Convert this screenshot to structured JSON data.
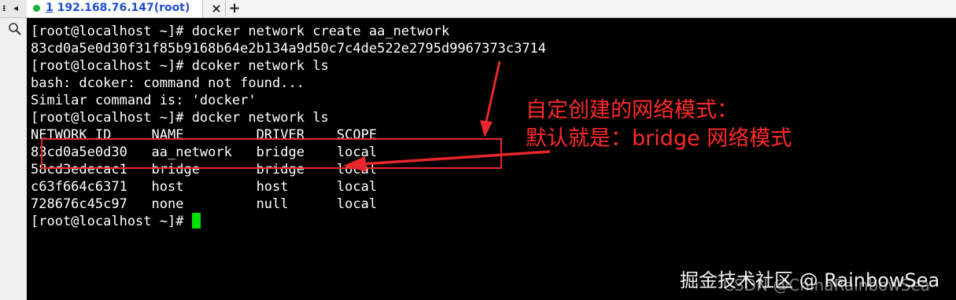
{
  "left_panel": {
    "pin_glyph": "ᵻ",
    "arrow_glyph": "◂",
    "search_icon": "magnifier"
  },
  "tabs": [
    {
      "number": "1",
      "title": "192.168.76.147(root)",
      "status_color": "#19b23b",
      "active": true
    }
  ],
  "tab_controls": {
    "close": "×",
    "add": "+"
  },
  "terminal": {
    "lines": [
      "[root@localhost ~]# docker network create aa_network",
      "83cd0a5e0d30f31f85b9168b64e2b134a9d50c7c4de522e2795d9967373c3714",
      "[root@localhost ~]# dcoker network ls",
      "bash: dcoker: command not found...",
      "Similar command is: 'docker'",
      "[root@localhost ~]# docker network ls",
      "NETWORK ID     NAME         DRIVER    SCOPE",
      "83cd0a5e0d30   aa_network   bridge    local",
      "58cd3edecac1   bridge       bridge    local",
      "c63f664c6371   host         host      local",
      "728676c45c97   none         null      local"
    ],
    "prompt": "[root@localhost ~]# ",
    "cursor_color": "#00e000"
  },
  "annotations": {
    "line1": "自定创建的网络模式：",
    "line2": "默认就是：bridge 网络模式",
    "color": "#ff2a2a"
  },
  "watermark": {
    "main": "掘金技术社区 @ RainbowSea",
    "under": "CSDN @ChinaRainbowSea"
  }
}
